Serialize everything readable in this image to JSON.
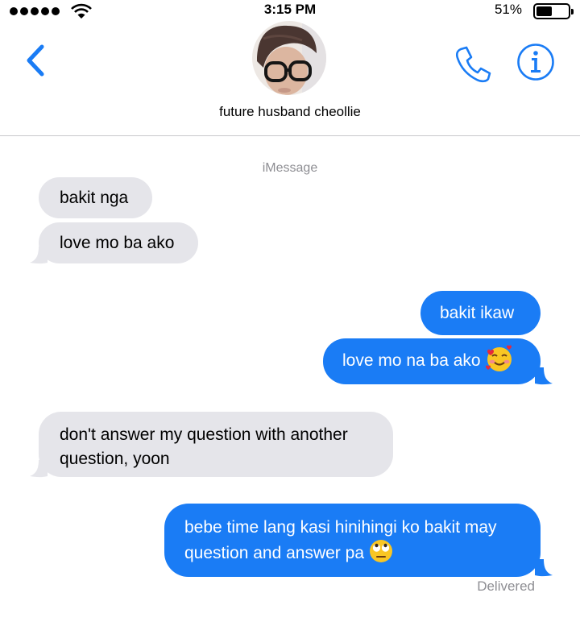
{
  "status_bar": {
    "time": "3:15 PM",
    "battery_percent": "51%",
    "battery_level": 0.51
  },
  "header": {
    "contact_name": "future husband cheollie"
  },
  "conversation": {
    "service_label": "iMessage",
    "messages": [
      {
        "direction": "incoming",
        "text": "bakit nga"
      },
      {
        "direction": "incoming",
        "text": "love mo ba ako"
      },
      {
        "direction": "outgoing",
        "text": "bakit ikaw"
      },
      {
        "direction": "outgoing",
        "text": "love mo na ba ako",
        "emoji": "smiling-face-with-hearts"
      },
      {
        "direction": "incoming",
        "line1": "don't answer my question with another",
        "line2": "question, yoon"
      },
      {
        "direction": "outgoing",
        "line1": "bebe time lang kasi hinihingi ko bakit may",
        "line2": "question and answer pa",
        "emoji": "face-with-rolling-eyes"
      }
    ],
    "delivered_label": "Delivered"
  },
  "colors": {
    "outgoing_bubble": "#1a7cf5",
    "incoming_bubble": "#e5e5ea",
    "accent": "#1a7cf5",
    "meta_text": "#8e8e93"
  }
}
